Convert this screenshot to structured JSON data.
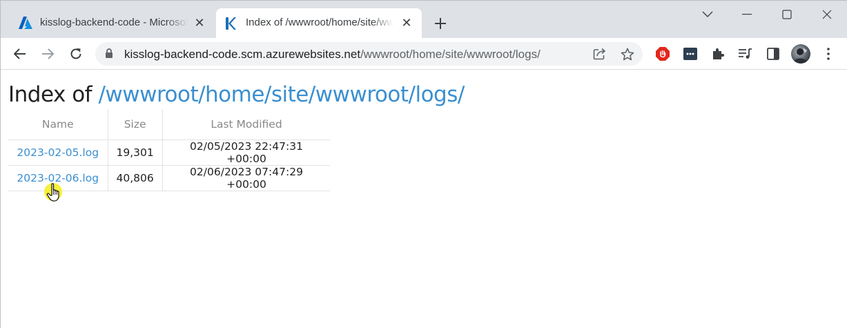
{
  "browser": {
    "tabs": [
      {
        "title": "kisslog-backend-code - Microsoft Azure",
        "active": false,
        "icon": "azure-icon"
      },
      {
        "title": "Index of /wwwroot/home/site/wwwroot/logs/",
        "active": true,
        "icon": "kudu-icon"
      }
    ],
    "address": {
      "host": "kisslog-backend-code.scm.azurewebsites.net",
      "path": "/wwwroot/home/site/wwwroot/logs/"
    },
    "colors": {
      "tabstrip": "#dee1e6",
      "omnibox": "#f1f3f4",
      "accent_link": "#3a8fd0"
    }
  },
  "page": {
    "heading_prefix": "Index of",
    "heading_path": "/wwwroot/home/site/wwwroot/logs/",
    "columns": {
      "name": "Name",
      "size": "Size",
      "modified": "Last Modified"
    },
    "files": [
      {
        "name": "2023-02-05.log",
        "size": "19,301",
        "modified": "02/05/2023 22:47:31 +00:00"
      },
      {
        "name": "2023-02-06.log",
        "size": "40,806",
        "modified": "02/06/2023 07:47:29 +00:00"
      }
    ]
  }
}
